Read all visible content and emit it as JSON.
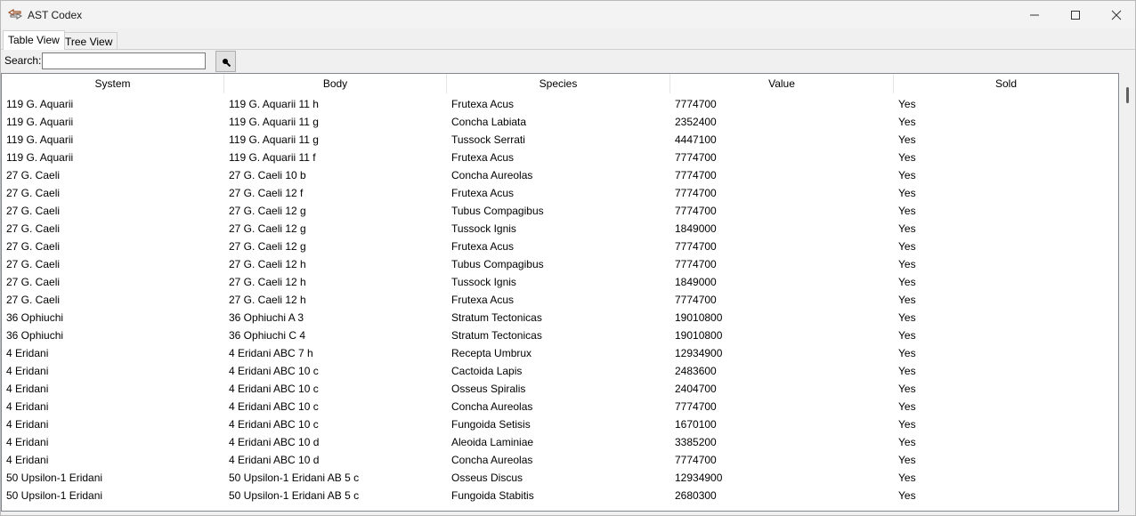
{
  "window": {
    "title": "AST Codex"
  },
  "tabs": [
    {
      "label": "Table View",
      "active": true
    },
    {
      "label": "Tree View",
      "active": false
    }
  ],
  "search": {
    "label": "Search:",
    "value": "",
    "button_icon": "search-icon"
  },
  "table": {
    "columns": [
      "System",
      "Body",
      "Species",
      "Value",
      "Sold"
    ],
    "rows": [
      [
        "119 G. Aquarii",
        "119 G. Aquarii 11 h",
        "Frutexa Acus",
        "7774700",
        "Yes"
      ],
      [
        "119 G. Aquarii",
        "119 G. Aquarii 11 g",
        "Concha Labiata",
        "2352400",
        "Yes"
      ],
      [
        "119 G. Aquarii",
        "119 G. Aquarii 11 g",
        "Tussock Serrati",
        "4447100",
        "Yes"
      ],
      [
        "119 G. Aquarii",
        "119 G. Aquarii 11 f",
        "Frutexa Acus",
        "7774700",
        "Yes"
      ],
      [
        "27 G. Caeli",
        "27 G. Caeli 10 b",
        "Concha Aureolas",
        "7774700",
        "Yes"
      ],
      [
        "27 G. Caeli",
        "27 G. Caeli 12 f",
        "Frutexa Acus",
        "7774700",
        "Yes"
      ],
      [
        "27 G. Caeli",
        "27 G. Caeli 12 g",
        "Tubus Compagibus",
        "7774700",
        "Yes"
      ],
      [
        "27 G. Caeli",
        "27 G. Caeli 12 g",
        "Tussock Ignis",
        "1849000",
        "Yes"
      ],
      [
        "27 G. Caeli",
        "27 G. Caeli 12 g",
        "Frutexa Acus",
        "7774700",
        "Yes"
      ],
      [
        "27 G. Caeli",
        "27 G. Caeli 12 h",
        "Tubus Compagibus",
        "7774700",
        "Yes"
      ],
      [
        "27 G. Caeli",
        "27 G. Caeli 12 h",
        "Tussock Ignis",
        "1849000",
        "Yes"
      ],
      [
        "27 G. Caeli",
        "27 G. Caeli 12 h",
        "Frutexa Acus",
        "7774700",
        "Yes"
      ],
      [
        "36 Ophiuchi",
        "36 Ophiuchi A 3",
        "Stratum Tectonicas",
        "19010800",
        "Yes"
      ],
      [
        "36 Ophiuchi",
        "36 Ophiuchi C 4",
        "Stratum Tectonicas",
        "19010800",
        "Yes"
      ],
      [
        "4 Eridani",
        "4 Eridani ABC 7 h",
        "Recepta Umbrux",
        "12934900",
        "Yes"
      ],
      [
        "4 Eridani",
        "4 Eridani ABC 10 c",
        "Cactoida Lapis",
        "2483600",
        "Yes"
      ],
      [
        "4 Eridani",
        "4 Eridani ABC 10 c",
        "Osseus Spiralis",
        "2404700",
        "Yes"
      ],
      [
        "4 Eridani",
        "4 Eridani ABC 10 c",
        "Concha Aureolas",
        "7774700",
        "Yes"
      ],
      [
        "4 Eridani",
        "4 Eridani ABC 10 c",
        "Fungoida Setisis",
        "1670100",
        "Yes"
      ],
      [
        "4 Eridani",
        "4 Eridani ABC 10 d",
        "Aleoida Laminiae",
        "3385200",
        "Yes"
      ],
      [
        "4 Eridani",
        "4 Eridani ABC 10 d",
        "Concha Aureolas",
        "7774700",
        "Yes"
      ],
      [
        "50 Upsilon-1 Eridani",
        "50 Upsilon-1 Eridani AB 5 c",
        "Osseus Discus",
        "12934900",
        "Yes"
      ],
      [
        "50 Upsilon-1 Eridani",
        "50 Upsilon-1 Eridani AB 5 c",
        "Fungoida Stabitis",
        "2680300",
        "Yes"
      ]
    ]
  },
  "icons": {
    "app": "app-logo-icon",
    "minimize": "minimize-icon",
    "maximize": "maximize-icon",
    "close": "close-icon"
  }
}
